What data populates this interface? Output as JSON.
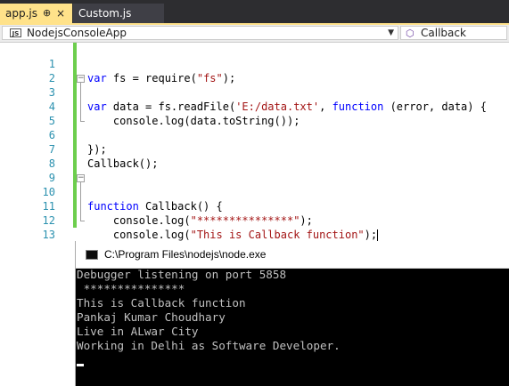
{
  "tabs": [
    {
      "label": "app.js",
      "pin_glyph": "⊕",
      "close_glyph": "×",
      "active": true
    },
    {
      "label": "Custom.js",
      "active": false
    }
  ],
  "navbar": {
    "project": "NodejsConsoleApp",
    "project_icon": "JS",
    "member": "Callback"
  },
  "editor": {
    "lines": [
      {
        "n": "1"
      },
      {
        "n": "2"
      },
      {
        "n": "3"
      },
      {
        "n": "4"
      },
      {
        "n": "5"
      },
      {
        "n": "6"
      },
      {
        "n": "7"
      },
      {
        "n": "8"
      },
      {
        "n": "9"
      },
      {
        "n": "10"
      },
      {
        "n": "11"
      },
      {
        "n": "12"
      },
      {
        "n": "13"
      }
    ],
    "code": {
      "l1_kw": "var",
      "l1_rest": " fs = require(",
      "l1_str": "\"fs\"",
      "l1_end": ");",
      "l3_kw": "var",
      "l3_a": " data = fs.readFile(",
      "l3_str": "'E:/data.txt'",
      "l3_b": ", ",
      "l3_kw2": "function",
      "l3_c": " (error, data) {",
      "l4": "    console.log(data.toString());",
      "l6": "});",
      "l7": "Callback();",
      "l10_kw": "function",
      "l10_rest": " Callback() {",
      "l11_a": "    console.log(",
      "l11_str": "\"***************\"",
      "l11_b": ");",
      "l12_a": "    console.log(",
      "l12_str": "\"This is Callback function\"",
      "l12_b": ");",
      "l13": "}"
    }
  },
  "console": {
    "title": "C:\\Program Files\\nodejs\\node.exe",
    "lines": [
      "Debugger listening on port 5858",
      " ***************",
      "This is Callback function",
      "Pankaj Kumar Choudhary",
      "Live in ALwar City",
      "Working in Delhi as Software Developer."
    ]
  }
}
